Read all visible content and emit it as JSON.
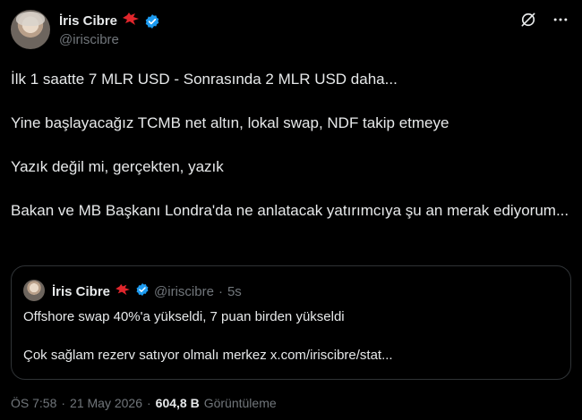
{
  "author": {
    "name": "İris Cibre",
    "handle": "@iriscibre"
  },
  "tweet": {
    "paragraphs": [
      "İlk 1 saatte 7 MLR USD - Sonrasında 2 MLR USD daha...",
      "Yine başlayacağız TCMB net altın, lokal swap, NDF takip etmeye",
      "Yazık değil mi, gerçekten, yazık",
      "Bakan ve MB Başkanı Londra'da ne anlatacak yatırımcıya şu an merak ediyorum..."
    ]
  },
  "quote": {
    "name": "İris Cibre",
    "handle": "@iriscibre",
    "separator": "·",
    "time": "5s",
    "line1": "Offshore swap 40%'a yükseldi, 7 puan birden yükseldi",
    "line2": "Çok sağlam rezerv satıyor olmalı merkez x.com/iriscibre/stat..."
  },
  "meta": {
    "time": "ÖS 7:58",
    "separator1": "·",
    "date": "21 May 2026",
    "separator2": "·",
    "views": "604,8 B",
    "views_label": "Görüntüleme"
  },
  "icons": {
    "bird": "red-bird-icon",
    "verified": "verified-badge-icon",
    "grok": "grok-icon",
    "more": "more-icon"
  },
  "colors": {
    "background": "#000000",
    "text": "#e7e9ea",
    "muted": "#71767b",
    "verified": "#1d9bf0",
    "bird": "#e0262c",
    "border": "#2f3336"
  }
}
